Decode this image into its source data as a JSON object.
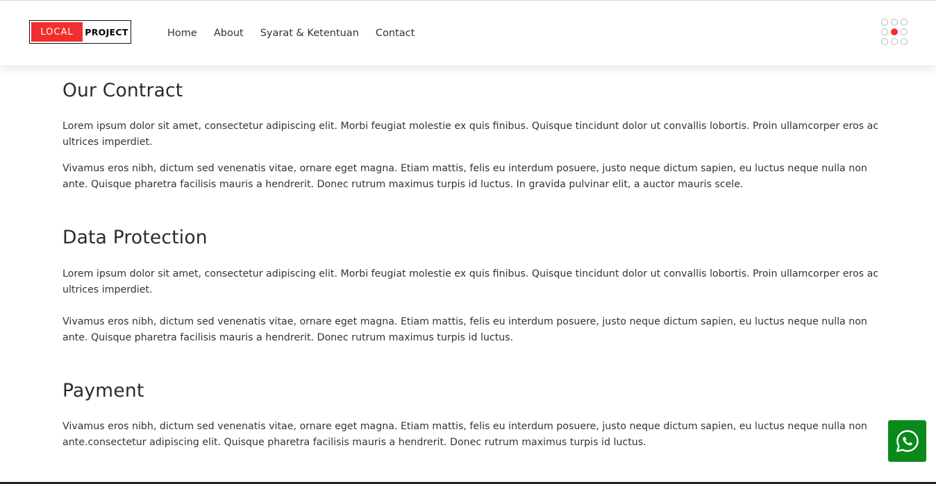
{
  "brand": {
    "left": "LOCAL",
    "right": "PROJECT",
    "accent": "#f22e2e"
  },
  "nav": {
    "items": [
      "Home",
      "About",
      "Syarat & Ketentuan",
      "Contact"
    ]
  },
  "menu_icon": "dots-grid-icon",
  "sections": [
    {
      "title": "Our Contract",
      "paragraphs": [
        "Lorem ipsum dolor sit amet, consectetur adipiscing elit. Morbi feugiat molestie ex quis finibus. Quisque tincidunt dolor ut convallis lobortis. Proin ullamcorper eros ac ultrices imperdiet.",
        "Vivamus eros nibh, dictum sed venenatis vitae, ornare eget magna. Etiam mattis, felis eu interdum posuere, justo neque dictum sapien, eu luctus neque nulla non ante. Quisque pharetra facilisis mauris a hendrerit. Donec rutrum maximus turpis id luctus. In gravida pulvinar elit, a auctor mauris scele."
      ]
    },
    {
      "title": "Data Protection",
      "paragraphs": [
        "Lorem ipsum dolor sit amet, consectetur adipiscing elit. Morbi feugiat molestie ex quis finibus. Quisque tincidunt dolor ut convallis lobortis. Proin ullamcorper eros ac ultrices imperdiet.",
        "Vivamus eros nibh, dictum sed venenatis vitae, ornare eget magna. Etiam mattis, felis eu interdum posuere, justo neque dictum sapien, eu luctus neque nulla non ante. Quisque pharetra facilisis mauris a hendrerit. Donec rutrum maximus turpis id luctus."
      ]
    },
    {
      "title": "Payment",
      "paragraphs": [
        "Vivamus eros nibh, dictum sed venenatis vitae, ornare eget magna. Etiam mattis, felis eu interdum posuere, justo neque dictum sapien, eu luctus neque nulla non ante.consectetur adipiscing elit. Quisque pharetra facilisis mauris a hendrerit. Donec rutrum maximus turpis id luctus."
      ]
    }
  ],
  "whatsapp": {
    "icon": "whatsapp-icon",
    "color": "#0a8a1a"
  }
}
